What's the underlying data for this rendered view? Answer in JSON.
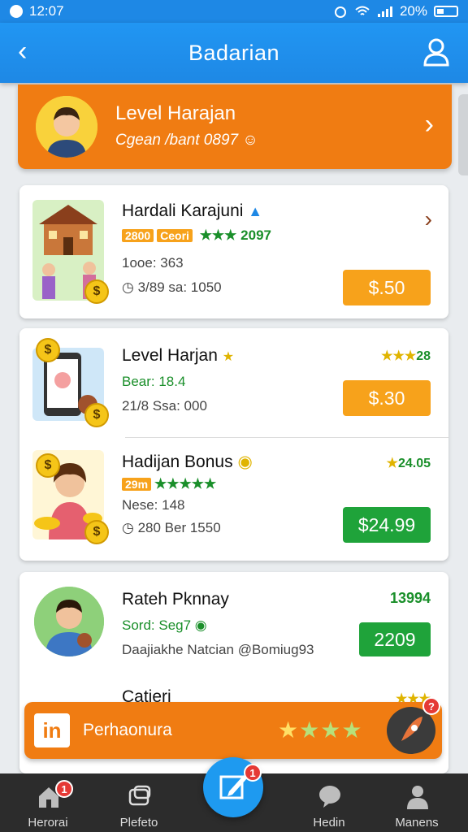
{
  "status_bar": {
    "time": "12:07",
    "battery": "20%"
  },
  "app_bar": {
    "title": "Badarian",
    "back_icon": "chevron-left-icon",
    "profile_icon": "user-icon"
  },
  "level_banner": {
    "title": "Level Harajan",
    "subtitle": "Cgean /bant 0897"
  },
  "items": [
    {
      "title": "Hardali Karajuni",
      "tag_price": "2800",
      "tag_label": "Ceori",
      "rating_text": "2097",
      "line1": "1ooe: 363",
      "line2": "3/89 sa: 1050",
      "price": "$.50"
    },
    {
      "title": "Level Harjan",
      "line1": "Bear: 18.4",
      "line2": "21/8 Ssa: 000",
      "rating_text": "28",
      "price": "$.30"
    },
    {
      "title": "Hadijan Bonus",
      "tag_price": "29m",
      "line1": "Nese: 148",
      "line2": "280 Ber 1550",
      "rating_text": "24.05",
      "price": "$24.99"
    },
    {
      "title": "Rateh Pknnay",
      "line1": "Sord: Seg7",
      "line2": "Daajiakhe Natcian @Bomiug93",
      "rating_text": "13994",
      "price": "2209"
    },
    {
      "title": "Catieri"
    }
  ],
  "promo": {
    "label": "Perhaonura",
    "logo": "in"
  },
  "bottom_nav": [
    {
      "label": "Herorai",
      "icon": "home-icon",
      "badge": "1"
    },
    {
      "label": "Plefeto",
      "icon": "chat-icon"
    },
    {
      "label": "Hedin",
      "icon": "message-icon"
    },
    {
      "label": "Manens",
      "icon": "person-icon"
    }
  ],
  "fab": {
    "icon": "edit-icon",
    "badge": "1"
  },
  "colors": {
    "primary": "#1e88e5",
    "accent": "#f07c12",
    "price_orange": "#f7a21b",
    "price_green": "#1fa33a"
  }
}
